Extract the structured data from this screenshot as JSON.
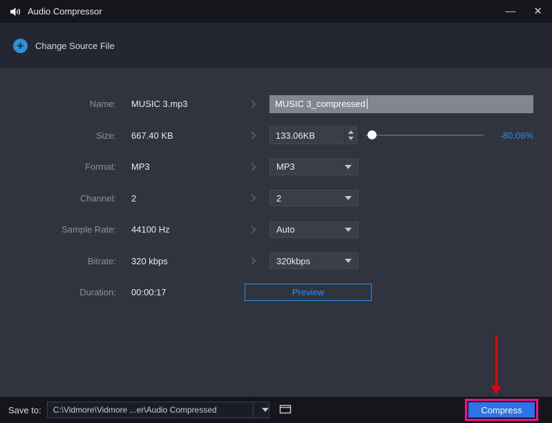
{
  "titlebar": {
    "title": "Audio Compressor",
    "minimize_glyph": "—",
    "close_glyph": "✕"
  },
  "header": {
    "plus_glyph": "+",
    "change_source": "Change Source File"
  },
  "rows": [
    {
      "label": "Name:",
      "value": "MUSIC 3.mp3",
      "input": "MUSIC 3_compressed"
    },
    {
      "label": "Size:",
      "value": "667.40 KB",
      "input": "133.06KB",
      "percent": "-80.06%"
    },
    {
      "label": "Format:",
      "value": "MP3",
      "select": "MP3"
    },
    {
      "label": "Channel:",
      "value": "2",
      "select": "2"
    },
    {
      "label": "Sample Rate:",
      "value": "44100 Hz",
      "select": "Auto"
    },
    {
      "label": "Bitrate:",
      "value": "320 kbps",
      "select": "320kbps"
    },
    {
      "label": "Duration:",
      "value": "00:00:17",
      "button": "Preview"
    }
  ],
  "footer": {
    "save_to_label": "Save to:",
    "path": "C:\\Vidmore\\Vidmore ...er\\Audio Compressed",
    "compress": "Compress"
  },
  "colors": {
    "accent_blue": "#2d8cf0",
    "compress_blue": "#2d72e8",
    "highlight_pink": "#f21291",
    "arrow_red": "#e60606"
  }
}
